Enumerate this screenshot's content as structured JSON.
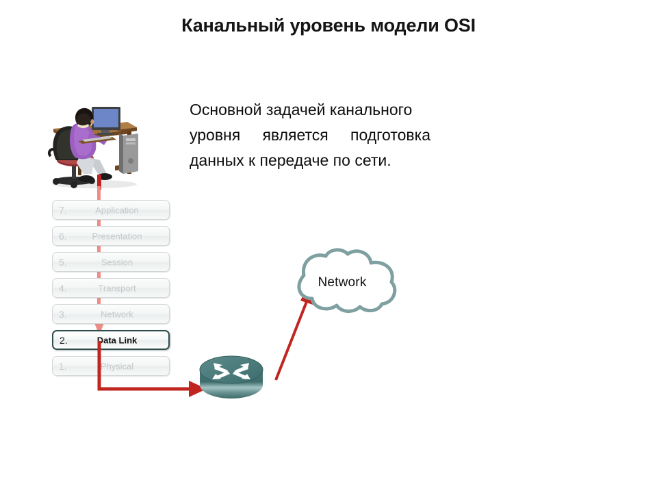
{
  "slide": {
    "title": "Канальный уровень модели OSI",
    "background_color": "#ffffff"
  },
  "body": {
    "line1": "Основной задачей канального",
    "line2": "уровня является подготовка",
    "line3": "данных к передаче по сети.",
    "full_text": "Основной задачей канального уровня является подготовка данных к передаче по сети."
  },
  "osi_stack": {
    "layers": [
      {
        "number": "7.",
        "name": "Application",
        "state": "dim"
      },
      {
        "number": "6.",
        "name": "Presentation",
        "state": "dim"
      },
      {
        "number": "5.",
        "name": "Session",
        "state": "dim"
      },
      {
        "number": "4.",
        "name": "Transport",
        "state": "dim"
      },
      {
        "number": "3.",
        "name": "Network",
        "state": "dim"
      },
      {
        "number": "2.",
        "name": "Data Link",
        "state": "active"
      },
      {
        "number": "1.",
        "name": "Physical",
        "state": "dim"
      }
    ],
    "highlighted_layer": "Data Link",
    "active_border_color": "#2f4d4d",
    "dim_text_color": "#c2c7c7"
  },
  "diagram": {
    "cloud_label": "Network",
    "cloud_outline_color": "#7fa0a0",
    "router_color": "#4d7e7e",
    "router_highlight_color": "#8fb3b3",
    "arrow_red_color": "#c0251f",
    "arrow_pink_color": "#f08c85",
    "person_shirt_color": "#9b5fc0",
    "person_pants_color": "#c9cdd2",
    "desk_color": "#8a5a2b",
    "monitor_screen_color": "#6d86c7"
  },
  "icons": {
    "person_at_desk": "person-at-computer-desk",
    "router": "cisco-router-icon",
    "cloud": "network-cloud-icon",
    "down_arrow": "down-arrow-icon",
    "elbow_arrow": "elbow-right-arrow-icon",
    "diagonal_arrow": "diagonal-up-arrow-icon"
  }
}
